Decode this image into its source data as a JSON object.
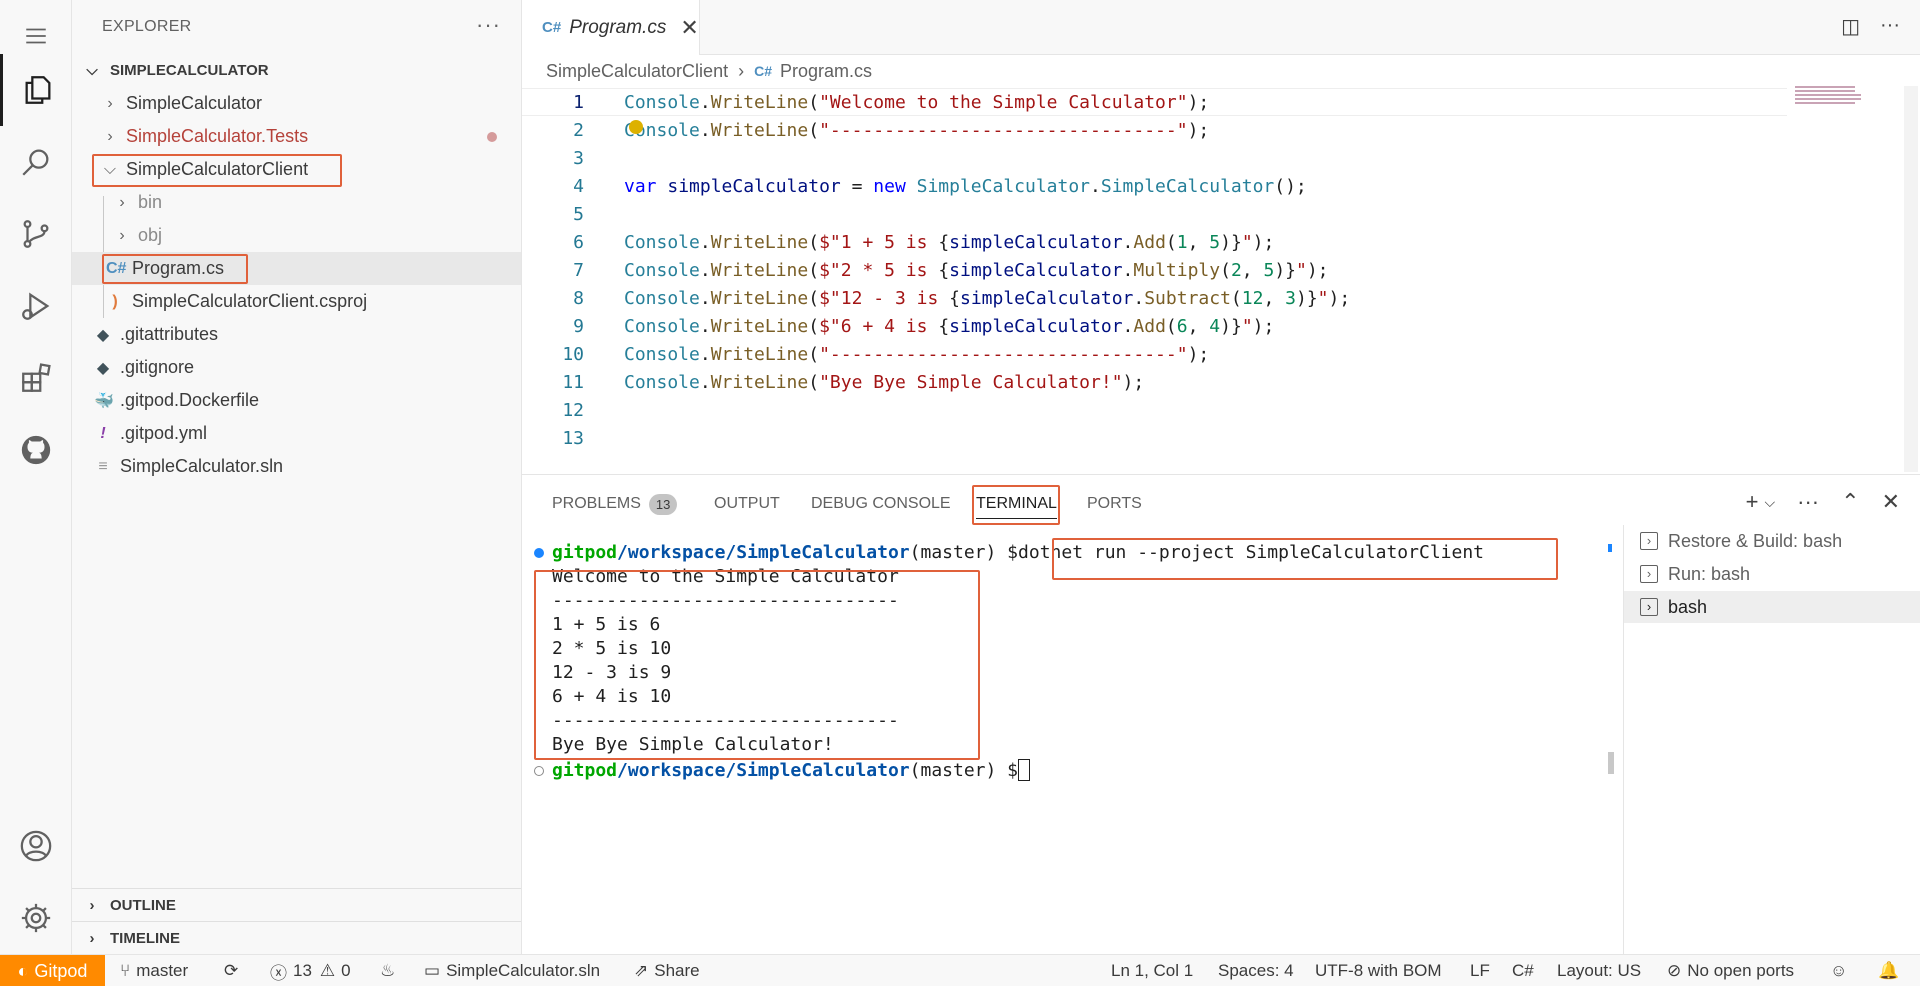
{
  "sidebar": {
    "header": "EXPLORER",
    "more": "···",
    "section": "SIMPLECALCULATOR",
    "items": [
      {
        "label": "SimpleCalculator",
        "kind": "folder",
        "open": false
      },
      {
        "label": "SimpleCalculator.Tests",
        "kind": "folder",
        "open": false,
        "modified": true
      },
      {
        "label": "SimpleCalculatorClient",
        "kind": "folder",
        "open": true
      },
      {
        "label": "bin",
        "kind": "folder",
        "open": false
      },
      {
        "label": "obj",
        "kind": "folder",
        "open": false
      },
      {
        "label": "Program.cs",
        "kind": "file"
      },
      {
        "label": "SimpleCalculatorClient.csproj",
        "kind": "file"
      },
      {
        "label": ".gitattributes",
        "kind": "file"
      },
      {
        "label": ".gitignore",
        "kind": "file"
      },
      {
        "label": ".gitpod.Dockerfile",
        "kind": "file"
      },
      {
        "label": ".gitpod.yml",
        "kind": "file"
      },
      {
        "label": "SimpleCalculator.sln",
        "kind": "file"
      }
    ],
    "outline": "OUTLINE",
    "timeline": "TIMELINE"
  },
  "editor": {
    "tab": "Program.cs",
    "tab_close": "✕",
    "breadcrumb": [
      "SimpleCalculatorClient",
      "Program.cs"
    ],
    "line_numbers": [
      "1",
      "2",
      "3",
      "4",
      "5",
      "6",
      "7",
      "8",
      "9",
      "10",
      "11",
      "12",
      "13"
    ]
  },
  "panel": {
    "tabs": [
      "PROBLEMS",
      "OUTPUT",
      "DEBUG CONSOLE",
      "TERMINAL",
      "PORTS"
    ],
    "problems_count": "13",
    "active_tab": "TERMINAL",
    "terminal": {
      "prompt_user": "gitpod",
      "prompt_path": "/workspace/SimpleCalculator",
      "prompt_branch": "(master) $",
      "command": "dotnet run --project SimpleCalculatorClient",
      "output": [
        "Welcome to the Simple Calculator",
        "--------------------------------",
        "1 + 5 is 6",
        "2 * 5 is 10",
        "12 - 3 is 9",
        "6 + 4 is 10",
        "--------------------------------",
        "Bye Bye Simple Calculator!"
      ]
    },
    "terminals": [
      "Restore & Build: bash",
      "Run: bash",
      "bash"
    ]
  },
  "status": {
    "remote": "Gitpod",
    "branch": "master",
    "errors": "13",
    "warnings": "0",
    "solution": "SimpleCalculator.sln",
    "share": "Share",
    "position": "Ln 1, Col 1",
    "spaces": "Spaces: 4",
    "encoding": "UTF-8 with BOM",
    "eol": "LF",
    "language": "C#",
    "layout": "Layout: US",
    "ports": "No open ports"
  },
  "colors": {
    "accent_remote": "#ff8a00",
    "highlight_box": "#e0613b",
    "modified_folder": "#b5423a"
  }
}
